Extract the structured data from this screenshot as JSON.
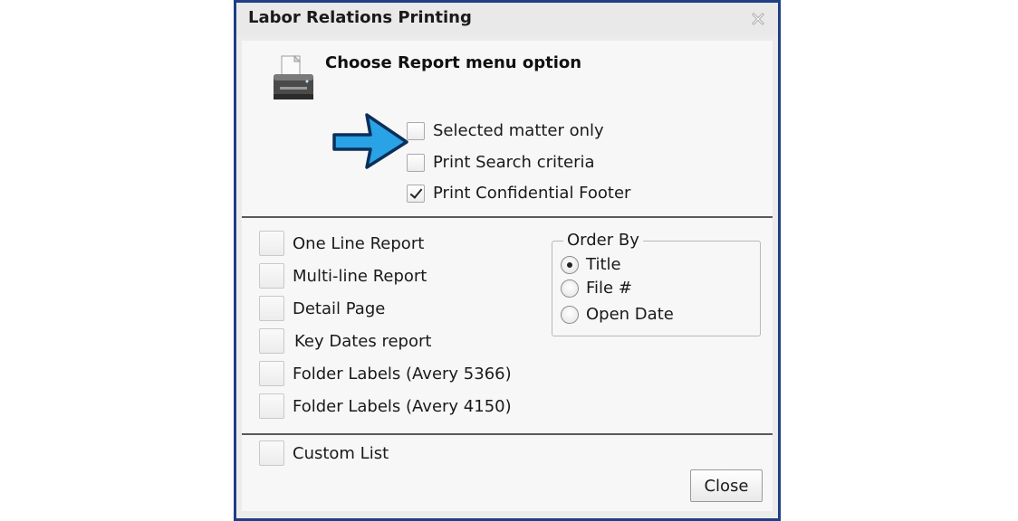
{
  "window": {
    "title": "Labor Relations Printing"
  },
  "header": {
    "heading": "Choose Report menu option"
  },
  "options": [
    {
      "label": "Selected matter only",
      "checked": false
    },
    {
      "label": "Print Search criteria",
      "checked": false
    },
    {
      "label": "Print Confidential Footer",
      "checked": true
    }
  ],
  "reports": [
    {
      "label": "One Line Report",
      "checked": false
    },
    {
      "label": "Multi-line Report",
      "checked": false
    },
    {
      "label": "Detail Page",
      "checked": false
    },
    {
      "label": "Key Dates report",
      "checked": false
    },
    {
      "label": "Folder Labels (Avery 5366)",
      "checked": false
    },
    {
      "label": "Folder Labels (Avery 4150)",
      "checked": false
    }
  ],
  "order_by": {
    "legend": "Order By",
    "options": [
      {
        "label": "Title",
        "selected": true
      },
      {
        "label": "File #",
        "selected": false
      },
      {
        "label": "Open Date",
        "selected": false
      }
    ]
  },
  "custom_list": {
    "label": "Custom List",
    "checked": false
  },
  "buttons": {
    "close_label": "Close"
  },
  "colors": {
    "window_border": "#1f3f86",
    "arrow_fill": "#2aa3e6",
    "arrow_outline": "#0b2f5a"
  },
  "icons": {
    "printer": "printer-icon",
    "arrow": "arrow-right-icon",
    "close": "close-icon"
  }
}
